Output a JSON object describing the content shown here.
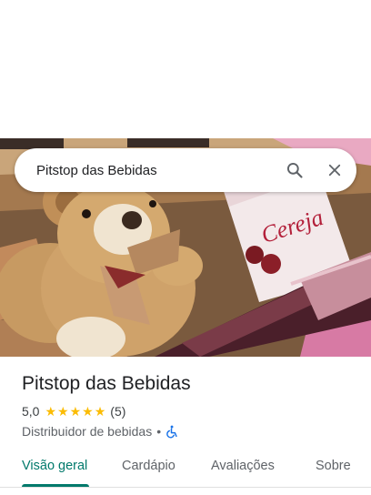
{
  "search": {
    "query": "Pitstop das Bebidas",
    "search_icon": "search-icon",
    "clear_icon": "close-icon"
  },
  "hero": {
    "product_box_text": "Cereja"
  },
  "place": {
    "name": "Pitstop das Bebidas",
    "rating": "5,0",
    "stars": 5,
    "reviews": "(5)",
    "category": "Distribuidor de bebidas",
    "separator": "•",
    "accessibility_icon": "wheelchair-icon"
  },
  "tabs": [
    {
      "label": "Visão geral",
      "active": true
    },
    {
      "label": "Cardápio",
      "active": false
    },
    {
      "label": "Avaliações",
      "active": false
    },
    {
      "label": "Sobre",
      "active": false
    }
  ],
  "colors": {
    "accent": "#00796b",
    "star": "#fbbc04",
    "text_primary": "#202124",
    "text_secondary": "#5f6368"
  }
}
